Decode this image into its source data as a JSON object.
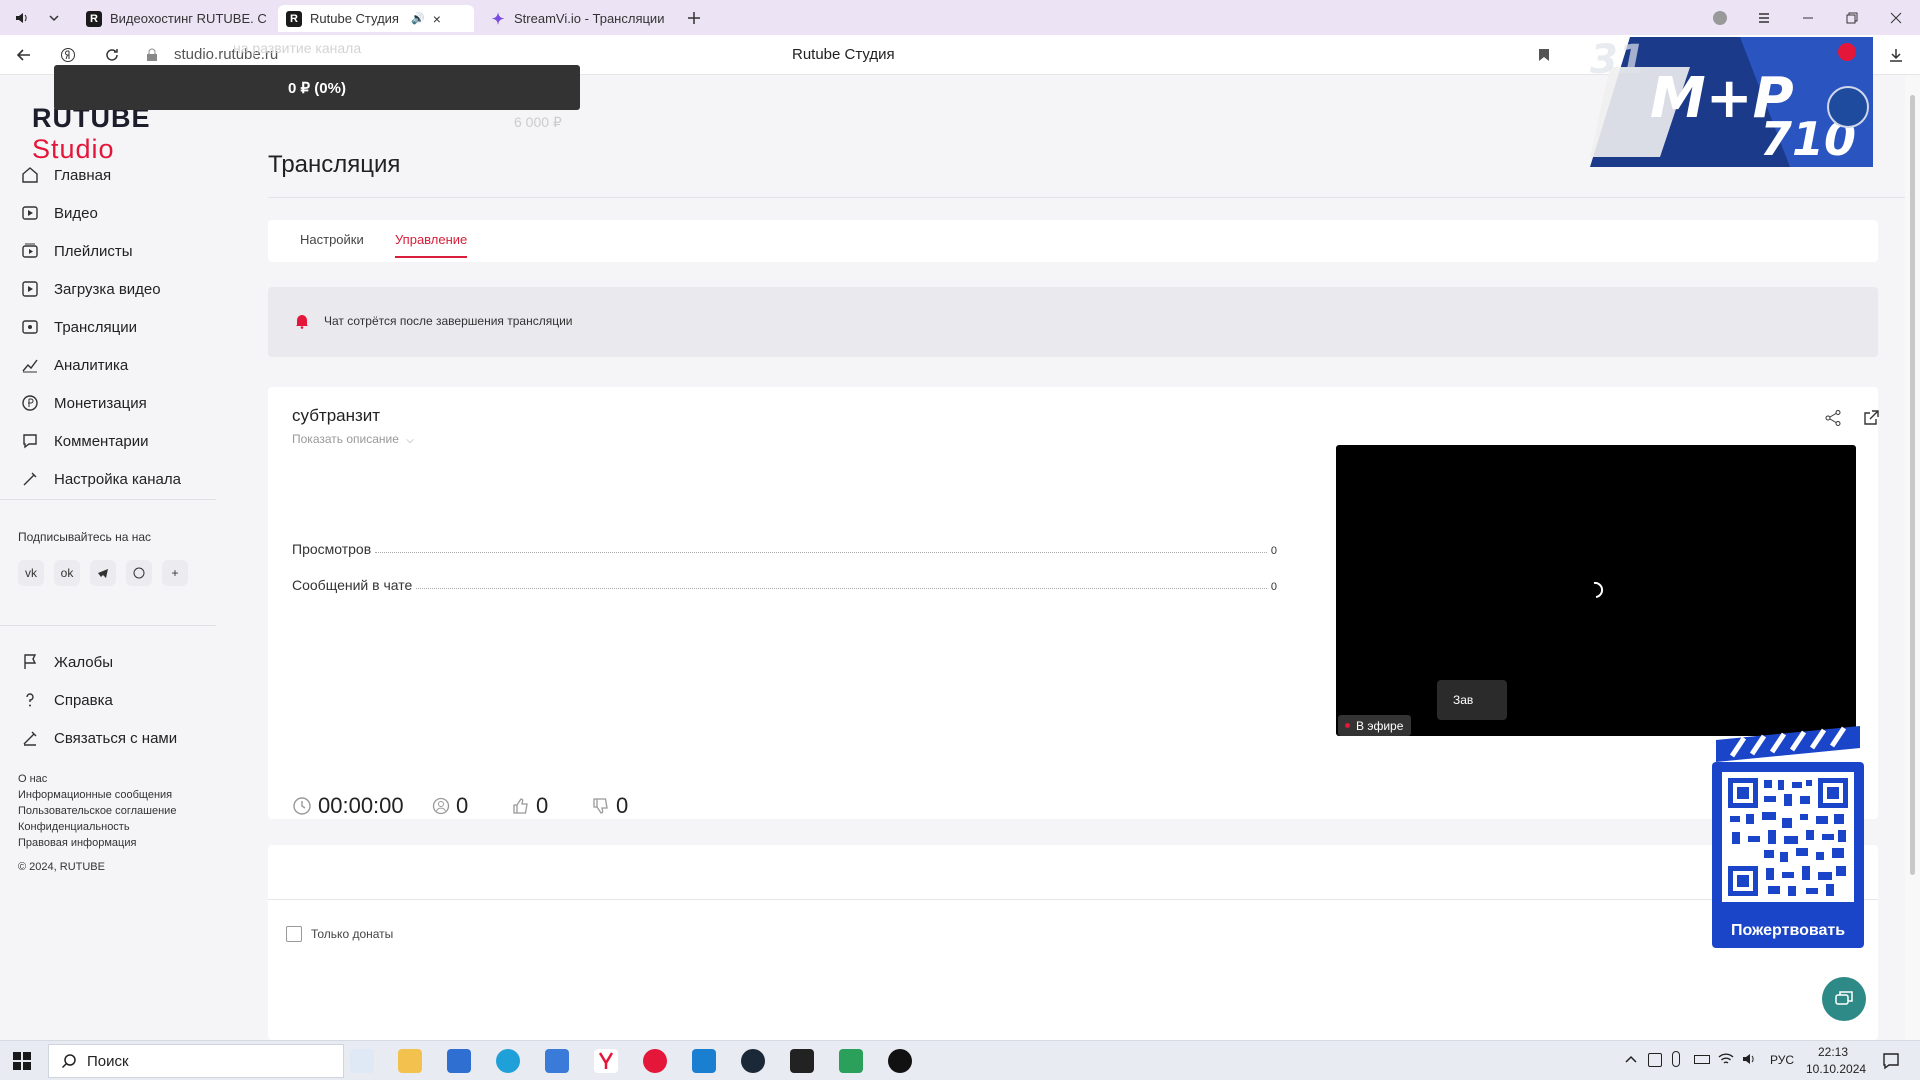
{
  "browser": {
    "tabs": [
      {
        "title": "Видеохостинг RUTUBE. С",
        "active": false,
        "icon": "rutube-favicon"
      },
      {
        "title": "Rutube Студия",
        "active": true,
        "icon": "rutube-favicon"
      },
      {
        "title": "StreamVi.io - Трансляции",
        "active": false,
        "icon": "streamvi-favicon"
      }
    ],
    "address": "studio.rutube.ru",
    "page_title": "Rutube Студия"
  },
  "donation_overlay": {
    "progress_text": "0 ₽ (0%)",
    "progress_fraction": 0,
    "goal_label": "на развитие канала",
    "goal": "6 000 ₽"
  },
  "sidebar": {
    "logo_main": "RUTUBE",
    "logo_sub": "Studio",
    "nav": [
      {
        "label": "Главная",
        "icon": "home-icon"
      },
      {
        "label": "Видео",
        "icon": "video-icon"
      },
      {
        "label": "Плейлисты",
        "icon": "playlist-icon"
      },
      {
        "label": "Загрузка видео",
        "icon": "upload-icon"
      },
      {
        "label": "Трансляции",
        "icon": "broadcast-icon"
      },
      {
        "label": "Аналитика",
        "icon": "analytics-icon"
      },
      {
        "label": "Монетизация",
        "icon": "monetization-icon"
      },
      {
        "label": "Комментарии",
        "icon": "comments-icon"
      },
      {
        "label": "Настройка канала",
        "icon": "channel-settings-icon"
      }
    ],
    "subscribe_label": "Подписывайтесь на нас",
    "socials": [
      "vk-icon",
      "ok-icon",
      "telegram-icon",
      "viber-icon",
      "more-icon"
    ],
    "support": [
      {
        "label": "Жалобы",
        "icon": "flag-icon"
      },
      {
        "label": "Справка",
        "icon": "help-icon"
      },
      {
        "label": "Связаться с нами",
        "icon": "contact-icon"
      }
    ],
    "footer_links": [
      "О нас",
      "Информационные сообщения",
      "Пользовательское соглашение",
      "Конфиденциальность",
      "Правовая информация"
    ],
    "copyright": "© 2024, RUTUBE"
  },
  "main": {
    "title": "Трансляция",
    "tabs": [
      {
        "label": "Настройки",
        "active": false
      },
      {
        "label": "Управление",
        "active": true
      }
    ],
    "notice": "Чат сотрётся после завершения трансляции",
    "stream": {
      "name": "субтранзит",
      "show_description": "Показать описание",
      "stats": [
        {
          "label": "Просмотров",
          "value": "0"
        },
        {
          "label": "Сообщений в чате",
          "value": "0"
        }
      ],
      "live_badge": "В эфире",
      "duration": "00:00:00",
      "viewers": "0",
      "likes": "0",
      "dislikes": "0",
      "end_button": "Зав"
    },
    "chat": {
      "donations_only": "Только донаты"
    }
  },
  "widgets": {
    "donate_label": "Пожертвовать"
  },
  "taskbar": {
    "search": "Поиск",
    "language": "РУС",
    "time": "22:13",
    "date": "10.10.2024"
  },
  "colors": {
    "accent": "#e4163a",
    "fab": "#2e8a86",
    "tabstrip": "#ece3f4"
  }
}
